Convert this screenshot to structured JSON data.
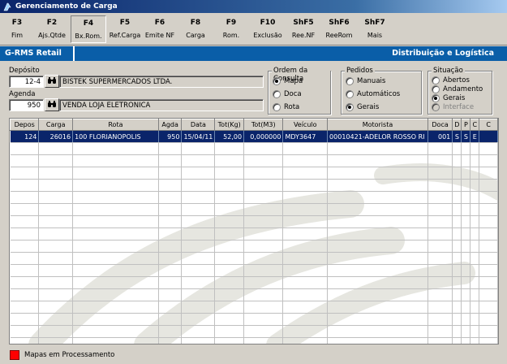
{
  "window": {
    "title": "Gerenciamento de Carga"
  },
  "toolbar": [
    {
      "key": "F3",
      "label": "Fim"
    },
    {
      "key": "F2",
      "label": "Ajs.Qtde"
    },
    {
      "key": "F4",
      "label": "Bx.Rom."
    },
    {
      "key": "F5",
      "label": "Ref.Carga"
    },
    {
      "key": "F6",
      "label": "Emite NF"
    },
    {
      "key": "F8",
      "label": "Carga"
    },
    {
      "key": "F9",
      "label": "Rom."
    },
    {
      "key": "F10",
      "label": "Exclusão"
    },
    {
      "key": "ShF5",
      "label": "Ree.NF"
    },
    {
      "key": "ShF6",
      "label": "ReeRom"
    },
    {
      "key": "ShF7",
      "label": "Mais"
    }
  ],
  "header": {
    "left": "G-RMS Retail",
    "right": "Distribuição e Logística"
  },
  "deposito": {
    "label": "Depósito",
    "code": "12-4",
    "name": "BISTEK SUPERMERCADOS LTDA."
  },
  "agenda": {
    "label": "Agenda",
    "code": "950",
    "name": "VENDA LOJA ELETRONICA"
  },
  "ordem": {
    "title": "Ordem da Consulta",
    "options": [
      {
        "label": "Mapa",
        "checked": true
      },
      {
        "label": "Doca",
        "checked": false
      },
      {
        "label": "Rota",
        "checked": false
      }
    ]
  },
  "pedidos": {
    "title": "Pedidos",
    "options": [
      {
        "label": "Manuais",
        "checked": false
      },
      {
        "label": "Automáticos",
        "checked": false
      },
      {
        "label": "Gerais",
        "checked": true
      }
    ]
  },
  "situacao": {
    "title": "Situação",
    "options": [
      {
        "label": "Abertos",
        "checked": false,
        "disabled": false
      },
      {
        "label": "Andamento",
        "checked": false,
        "disabled": false
      },
      {
        "label": "Gerais",
        "checked": true,
        "disabled": false
      },
      {
        "label": "Interface",
        "checked": false,
        "disabled": true
      }
    ]
  },
  "grid": {
    "columns": [
      "Depos",
      "Carga",
      "Rota",
      "Agda",
      "Data",
      "Tot(Kg)",
      "Tot(M3)",
      "Veículo",
      "Motorista",
      "Doca",
      "D",
      "P",
      "C",
      "C"
    ],
    "rows": [
      [
        "124",
        "26016",
        "100  FLORIANOPOLIS",
        "950",
        "15/04/11",
        "52,00",
        "0,000000",
        "MDY3647",
        "00010421-ADELOR ROSSO RI",
        "001",
        "S",
        "S",
        "E",
        ""
      ]
    ]
  },
  "status": {
    "legend": "Mapas em Processamento",
    "legend_color": "#ff0000"
  }
}
